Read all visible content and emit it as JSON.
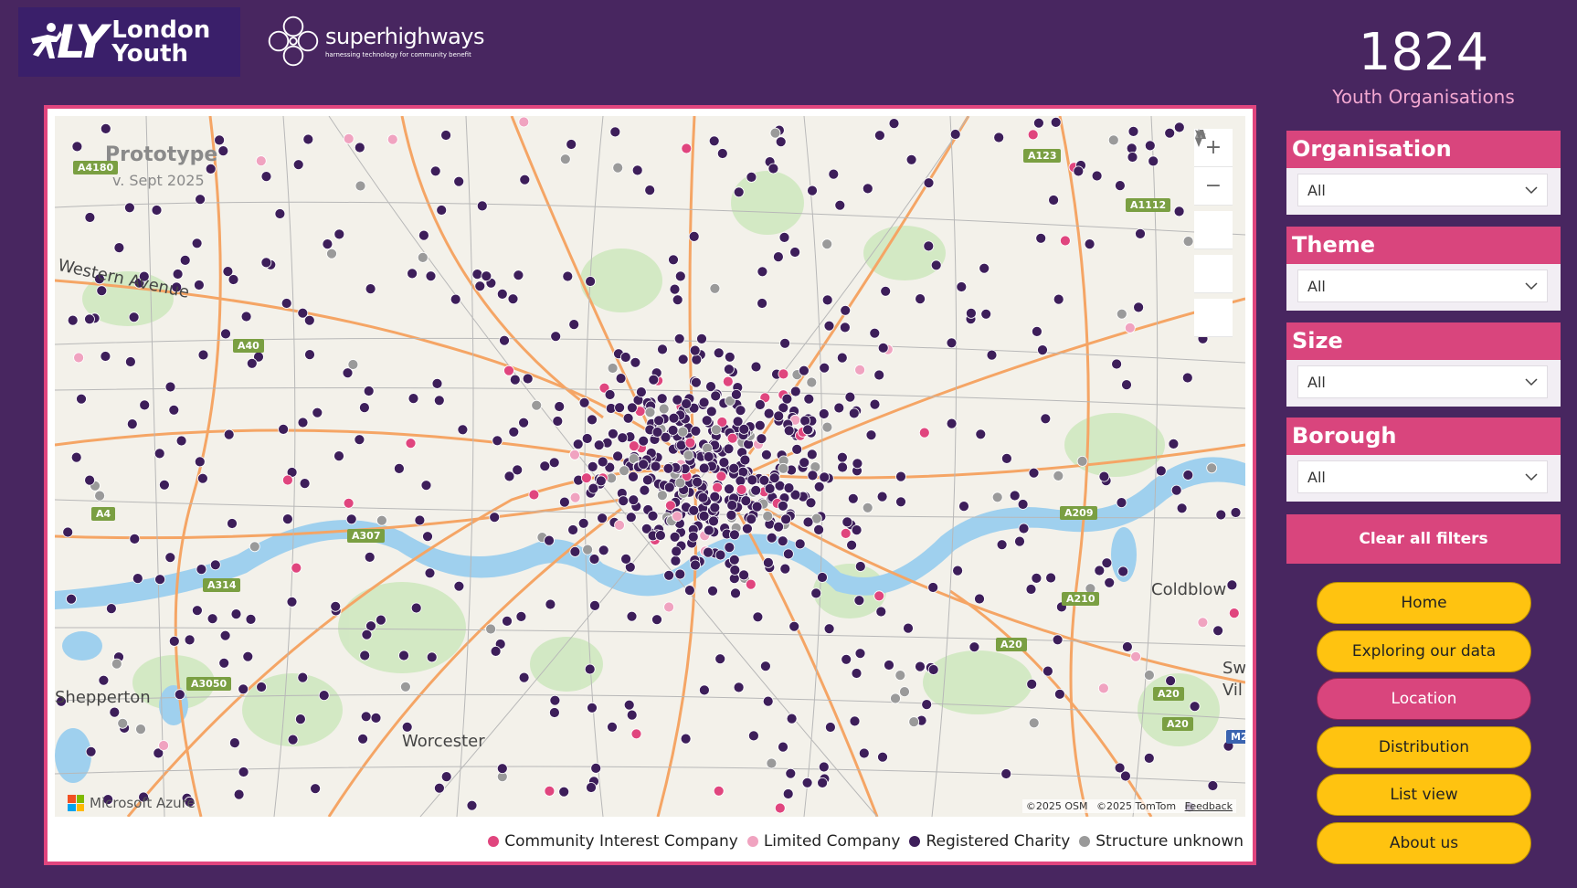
{
  "header": {
    "ly_logo_mark": "LY",
    "ly_logo_line1": "London",
    "ly_logo_line2": "Youth",
    "partner_name": "superhighways",
    "partner_tagline": "harnessing technology for community benefit"
  },
  "summary": {
    "count": "1824",
    "label": "Youth Organisations"
  },
  "map": {
    "watermark_title": "Prototype",
    "watermark_version": "v. Sept 2025",
    "provider": "Microsoft Azure",
    "attribution_osm": "©2025 OSM",
    "attribution_tomtom": "©2025 TomTom",
    "feedback": "Feedback",
    "controls": [
      "zoom-in",
      "zoom-out",
      "tilt",
      "compass",
      "select"
    ],
    "places": [
      "Western Avenue",
      "Coldblow",
      "Shepperton",
      "Worcester",
      "Swanley",
      "Vil"
    ],
    "road_labels": [
      "A4180",
      "A40",
      "A4",
      "A307",
      "A314",
      "A3050",
      "A123",
      "A1112",
      "A209",
      "A210",
      "A20",
      "A20",
      "A20",
      "M2"
    ],
    "colors": {
      "community_interest_company": "#e0457e",
      "limited_company": "#f0a3c0",
      "registered_charity": "#3d1e5a",
      "structure_unknown": "#9a9a9a"
    }
  },
  "legend": [
    {
      "label": "Community Interest Company",
      "color": "#e0457e"
    },
    {
      "label": "Limited Company",
      "color": "#f0a3c0"
    },
    {
      "label": "Registered Charity",
      "color": "#3d1e5a"
    },
    {
      "label": "Structure unknown",
      "color": "#9a9a9a"
    }
  ],
  "filters": {
    "organisation": {
      "label": "Organisation",
      "value": "All"
    },
    "theme": {
      "label": "Theme",
      "value": "All"
    },
    "size": {
      "label": "Size",
      "value": "All"
    },
    "borough": {
      "label": "Borough",
      "value": "All"
    }
  },
  "clear_label": "Clear all filters",
  "nav": [
    "Home",
    "Exploring our data",
    "Location",
    "Distribution",
    "List view",
    "About us"
  ],
  "nav_active": "Location"
}
